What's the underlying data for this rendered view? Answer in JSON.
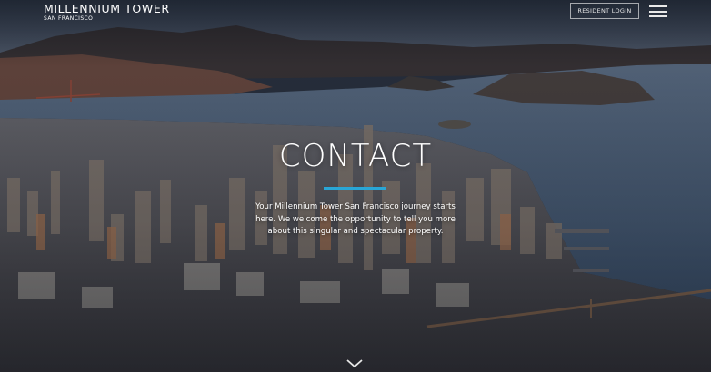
{
  "header": {
    "brand_name": "MILLENNIUM TOWER",
    "brand_sub": "SAN FRANCISCO",
    "resident_login_label": "RESIDENT LOGIN",
    "menu_icon": "hamburger-menu-icon"
  },
  "hero": {
    "title": "CONTACT",
    "intro": "Your Millennium Tower San Francisco journey starts here. We welcome the opportunity to tell you more about this singular and spectacular property.",
    "accent_color": "#29a6d6",
    "scroll_icon": "chevron-down-icon",
    "background": "aerial-san-francisco-skyline-photo"
  }
}
